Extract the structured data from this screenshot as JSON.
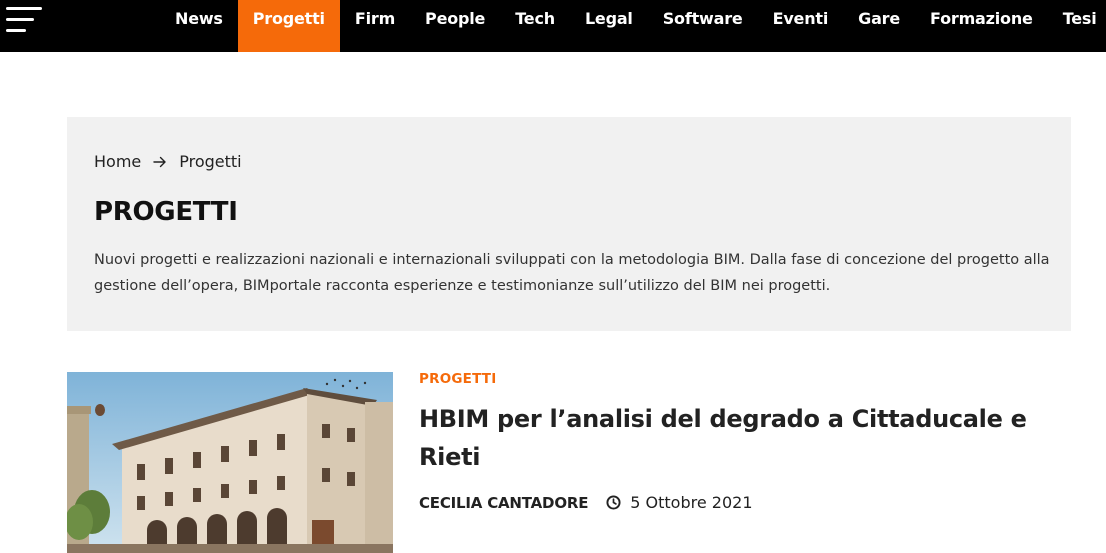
{
  "nav": {
    "items": [
      {
        "label": "News",
        "active": false
      },
      {
        "label": "Progetti",
        "active": true
      },
      {
        "label": "Firm",
        "active": false
      },
      {
        "label": "People",
        "active": false
      },
      {
        "label": "Tech",
        "active": false
      },
      {
        "label": "Legal",
        "active": false
      },
      {
        "label": "Software",
        "active": false
      },
      {
        "label": "Eventi",
        "active": false
      },
      {
        "label": "Gare",
        "active": false
      },
      {
        "label": "Formazione",
        "active": false
      },
      {
        "label": "Tesi",
        "active": false
      }
    ],
    "menu_icon": "hamburger-icon"
  },
  "colors": {
    "accent": "#f56a0a",
    "topbar": "#000000",
    "panel": "#f1f1f1"
  },
  "breadcrumb": {
    "home": "Home",
    "current": "Progetti",
    "separator_icon": "arrow-right-icon"
  },
  "header": {
    "title": "PROGETTI",
    "description": "Nuovi progetti e realizzazioni nazionali e internazionali sviluppati con la metodologia BIM. Dalla fase di concezione del progetto alla gestione dell’opera, BIMportale racconta esperienze e testimonianze sull’utilizzo del BIM nei progetti."
  },
  "article": {
    "category": "PROGETTI",
    "title": "HBIM per l’analisi del degrado a Cittaducale e Rieti",
    "author": "CECILIA CANTADORE",
    "date": "5 Ottobre 2021",
    "date_icon": "clock-icon"
  }
}
